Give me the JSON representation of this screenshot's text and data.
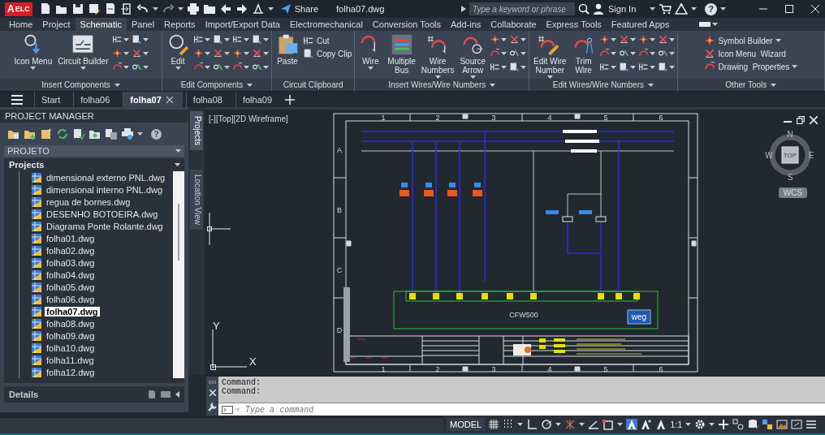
{
  "title_bar": {
    "app_letter": "A",
    "app_badge": "ELC",
    "share": "Share",
    "document_title": "folha07.dwg",
    "search": {
      "placeholder": "Type a keyword or phrase"
    },
    "sign_in": "Sign In",
    "help": "?"
  },
  "ribbon_tabs": [
    {
      "label": "Home",
      "selected": false
    },
    {
      "label": "Project",
      "selected": false
    },
    {
      "label": "Schematic",
      "selected": true
    },
    {
      "label": "Panel",
      "selected": false
    },
    {
      "label": "Reports",
      "selected": false
    },
    {
      "label": "Import/Export Data",
      "selected": false
    },
    {
      "label": "Electromechanical",
      "selected": false
    },
    {
      "label": "Conversion Tools",
      "selected": false
    },
    {
      "label": "Add-ins",
      "selected": false
    },
    {
      "label": "Collaborate",
      "selected": false
    },
    {
      "label": "Express Tools",
      "selected": false
    },
    {
      "label": "Featured Apps",
      "selected": false
    }
  ],
  "ribbon_panels": [
    {
      "title": "Insert Components",
      "dropdown": true,
      "tools": [
        {
          "kind": "large",
          "label": "Icon Menu",
          "dropdown": true
        },
        {
          "kind": "large",
          "label": "Circuit Builder",
          "dropdown": true
        },
        {
          "kind": "icon-grid"
        }
      ]
    },
    {
      "title": "Edit Components",
      "dropdown": true,
      "tools": [
        {
          "kind": "large",
          "label": "Edit",
          "dropdown": true
        },
        {
          "kind": "icon-grid"
        },
        {
          "kind": "icon-grid"
        }
      ]
    },
    {
      "title": "Circuit Clipboard",
      "dropdown": false,
      "tools": [
        {
          "kind": "large",
          "label": "Paste",
          "dropdown": false
        },
        {
          "kind": "stack",
          "items": [
            {
              "label": "Cut",
              "dropdown": false
            },
            {
              "label": "Copy Clip",
              "dropdown": false
            }
          ]
        }
      ]
    },
    {
      "title": "Insert Wires/Wire Numbers",
      "dropdown": true,
      "tools": [
        {
          "kind": "large",
          "label": "Wire",
          "dropdown": true
        },
        {
          "kind": "large",
          "label": "Multiple\nBus",
          "dropdown": false
        },
        {
          "kind": "large",
          "label": "Wire\nNumbers",
          "dropdown": true
        },
        {
          "kind": "large",
          "label": "Source\nArrow",
          "dropdown": true
        },
        {
          "kind": "icon-grid"
        }
      ]
    },
    {
      "title": "Edit Wires/Wire Numbers",
      "dropdown": true,
      "tools": [
        {
          "kind": "large",
          "label": "Edit Wire\nNumber",
          "dropdown": true
        },
        {
          "kind": "large",
          "label": "Trim\nWire",
          "dropdown": false
        },
        {
          "kind": "icon-grid"
        },
        {
          "kind": "icon-grid"
        }
      ]
    },
    {
      "title": "Other Tools",
      "dropdown": true,
      "tools": [
        {
          "kind": "stack",
          "items": [
            {
              "label": "Symbol Builder",
              "dropdown": true
            },
            {
              "label": "Icon Menu  Wizard",
              "dropdown": false
            },
            {
              "label": "Drawing  Properties",
              "dropdown": true
            }
          ]
        }
      ]
    }
  ],
  "document_tabs": [
    {
      "label": "Start",
      "selected": false
    },
    {
      "label": "folha06",
      "selected": false
    },
    {
      "label": "folha07",
      "selected": true
    },
    {
      "label": "folha08",
      "selected": false
    },
    {
      "label": "folha09",
      "selected": false
    }
  ],
  "project_manager": {
    "title": "PROJECT MANAGER",
    "help": "?",
    "project_select": "PROJETO",
    "section": "Projects",
    "files": [
      {
        "label": "dimensional externo PNL.dwg",
        "selected": false
      },
      {
        "label": "dimensional interno PNL.dwg",
        "selected": false
      },
      {
        "label": "regua de bornes.dwg",
        "selected": false
      },
      {
        "label": "DESENHO BOTOEIRA.dwg",
        "selected": false
      },
      {
        "label": "Diagrama Ponte Rolante.dwg",
        "selected": false
      },
      {
        "label": "folha01.dwg",
        "selected": false
      },
      {
        "label": "folha02.dwg",
        "selected": false
      },
      {
        "label": "folha03.dwg",
        "selected": false
      },
      {
        "label": "folha04.dwg",
        "selected": false
      },
      {
        "label": "folha05.dwg",
        "selected": false
      },
      {
        "label": "folha06.dwg",
        "selected": false
      },
      {
        "label": "folha07.dwg",
        "selected": true
      },
      {
        "label": "folha08.dwg",
        "selected": false
      },
      {
        "label": "folha09.dwg",
        "selected": false
      },
      {
        "label": "folha10.dwg",
        "selected": false
      },
      {
        "label": "folha11.dwg",
        "selected": false
      },
      {
        "label": "folha12.dwg",
        "selected": false
      }
    ],
    "details": "Details"
  },
  "side_tabs": [
    {
      "label": "Projects",
      "selected": true
    },
    {
      "label": "Location View",
      "selected": false
    }
  ],
  "viewport": {
    "view_label": "[-][Top][2D Wireframe]",
    "ucs": {
      "y": "Y",
      "x": "X"
    },
    "view_cube": {
      "north": "N",
      "south": "S",
      "east": "E",
      "west": "W",
      "face": "TOP",
      "wcs": "WCS"
    },
    "sheet": {
      "top_ruler": [
        "1",
        "2",
        "3",
        "4",
        "5",
        "6"
      ],
      "bottom_ruler": [
        "1",
        "2",
        "3",
        "4",
        "5",
        "6"
      ],
      "row_letters": [
        "A",
        "B",
        "C",
        "D"
      ],
      "device_label": "CFW500",
      "logo_text": "weg"
    }
  },
  "command": {
    "history": [
      "Command:",
      "Command:"
    ],
    "input": {
      "placeholder": "Type a command"
    }
  },
  "status_bar": {
    "model": "MODEL",
    "scale": "1:1"
  }
}
